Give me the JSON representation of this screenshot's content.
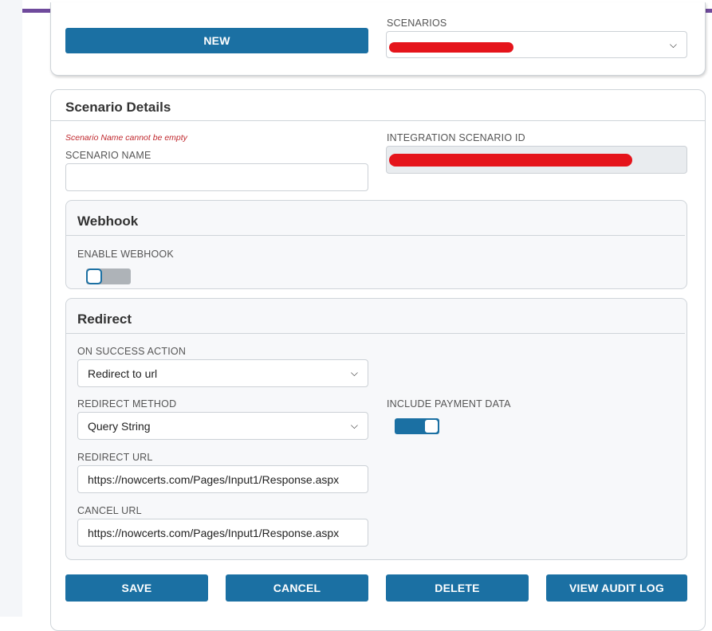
{
  "top": {
    "new_label": "NEW",
    "scenarios_label": "SCENARIOS",
    "scenarios_value": ""
  },
  "details": {
    "title": "Scenario Details",
    "error_text": "Scenario Name cannot be empty",
    "scenario_name_label": "SCENARIO NAME",
    "scenario_name_value": "",
    "integration_id_label": "INTEGRATION SCENARIO ID",
    "integration_id_value": ""
  },
  "webhook": {
    "title": "Webhook",
    "enable_label": "ENABLE WEBHOOK",
    "enabled": false
  },
  "redirect": {
    "title": "Redirect",
    "on_success_label": "ON SUCCESS ACTION",
    "on_success_value": "Redirect to url",
    "method_label": "REDIRECT METHOD",
    "method_value": "Query String",
    "include_payment_label": "INCLUDE PAYMENT DATA",
    "include_payment": true,
    "redirect_url_label": "REDIRECT URL",
    "redirect_url_value": "https://nowcerts.com/Pages/Input1/Response.aspx",
    "cancel_url_label": "CANCEL URL",
    "cancel_url_value": "https://nowcerts.com/Pages/Input1/Response.aspx"
  },
  "actions": {
    "save": "SAVE",
    "cancel": "CANCEL",
    "delete": "DELETE",
    "audit": "VIEW AUDIT LOG"
  },
  "colors": {
    "accent": "#1b70a3",
    "top_bar": "#6f4a9c",
    "error": "#c0282e",
    "redaction": "#e5141b"
  },
  "icons": {
    "select_chevron": "chevron-down-icon"
  }
}
